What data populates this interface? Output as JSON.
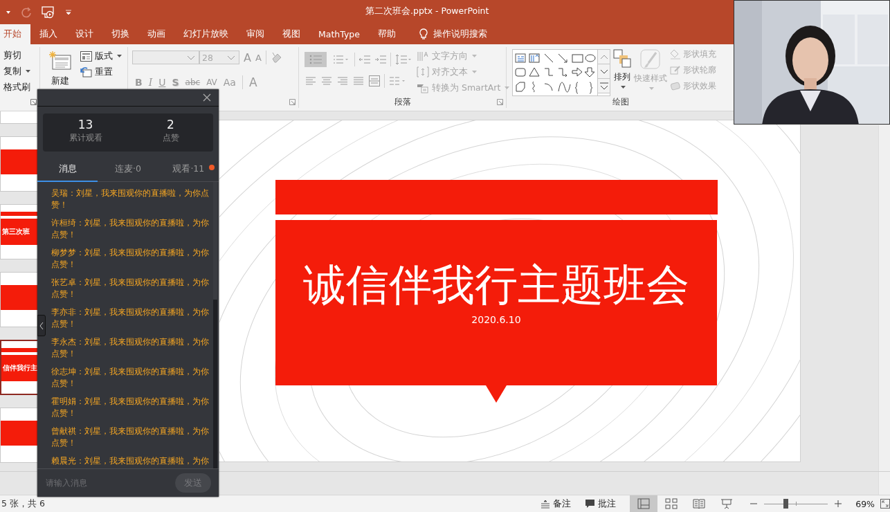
{
  "window": {
    "title": "第二次班会.pptx - PowerPoint"
  },
  "ribbon_tabs": [
    {
      "label": "开始",
      "selected": true
    },
    {
      "label": "插入",
      "selected": false
    },
    {
      "label": "设计",
      "selected": false
    },
    {
      "label": "切换",
      "selected": false
    },
    {
      "label": "动画",
      "selected": false
    },
    {
      "label": "幻灯片放映",
      "selected": false
    },
    {
      "label": "审阅",
      "selected": false
    },
    {
      "label": "视图",
      "selected": false
    },
    {
      "label": "MathType",
      "selected": false
    },
    {
      "label": "帮助",
      "selected": false
    }
  ],
  "tell_me": "操作说明搜索",
  "clipboard": {
    "commands": [
      "剪切",
      "复制",
      "格式刷"
    ]
  },
  "slides_group": {
    "new_slide": "新建",
    "commands": [
      "版式",
      "重置"
    ]
  },
  "font": {
    "disabled": true,
    "size": "28",
    "buttons": [
      {
        "label": "A",
        "kind": "grow"
      },
      {
        "label": "A",
        "kind": "shrink"
      },
      {
        "label": "B",
        "kind": "bold"
      },
      {
        "label": "I",
        "kind": "italic"
      },
      {
        "label": "U",
        "kind": "underline"
      },
      {
        "label": "S",
        "kind": "shadow"
      },
      {
        "label": "abc",
        "kind": "strike"
      },
      {
        "label": "AV",
        "kind": "spacing"
      },
      {
        "label": "Aa",
        "kind": "case"
      },
      {
        "label": "A",
        "kind": "color"
      }
    ]
  },
  "paragraph": {
    "disabled": true,
    "label": "段落",
    "commands": [
      "文字方向",
      "对齐文本",
      "转换为 SmartArt"
    ]
  },
  "drawing": {
    "label": "绘图",
    "arrange": "排列",
    "quick_styles": {
      "label": "快速样式",
      "disabled": true
    },
    "commands": [
      {
        "label": "形状填充",
        "disabled": true
      },
      {
        "label": "形状轮廓",
        "disabled": true
      },
      {
        "label": "形状效果",
        "disabled": true
      }
    ]
  },
  "thumbnails": [
    {
      "kind": "title",
      "selected": false
    },
    {
      "kind": "content",
      "selected": false
    },
    {
      "kind": "title",
      "title": "第三次班",
      "selected": false
    },
    {
      "kind": "content",
      "selected": false
    },
    {
      "kind": "title",
      "title": "信伴我行主",
      "selected": true
    },
    {
      "kind": "content",
      "selected": false
    }
  ],
  "slide": {
    "title": "诚信伴我行主题班会",
    "date": "2020.6.10"
  },
  "live_panel": {
    "stats": [
      {
        "value": "13",
        "label": "累计观看"
      },
      {
        "value": "2",
        "label": "点赞"
      }
    ],
    "tabs": [
      {
        "label": "消息",
        "selected": true,
        "badge": false
      },
      {
        "label": "连麦·0",
        "selected": false,
        "badge": false
      },
      {
        "label": "观看·11",
        "selected": false,
        "badge": true
      }
    ],
    "messages": [
      "吴瑞：刘星，我来围观你的直播啦，为你点赞！",
      "许桓绮：刘星，我来围观你的直播啦，为你点赞！",
      "柳梦梦：刘星，我来围观你的直播啦，为你点赞！",
      "张艺卓：刘星，我来围观你的直播啦，为你点赞！",
      "李亦非：刘星，我来围观你的直播啦，为你点赞！",
      "李永杰：刘星，我来围观你的直播啦，为你点赞！",
      "徐志坤：刘星，我来围观你的直播啦，为你点赞！",
      "霍明娟：刘星，我来围观你的直播啦，为你点赞！",
      "曾献祺：刘星，我来围观你的直播啦，为你点赞！",
      "赖晨光：刘星，我来围观你的直播啦，为你"
    ],
    "input": {
      "placeholder": "请输入消息"
    },
    "send_button": {
      "label": "发送",
      "disabled": true
    }
  },
  "status_bar": {
    "slide_count": "5 张，共 6",
    "notes": "备注",
    "comments": "批注",
    "views": [
      {
        "kind": "normal",
        "selected": true
      },
      {
        "kind": "sorter",
        "selected": false
      },
      {
        "kind": "reading",
        "selected": false
      },
      {
        "kind": "show",
        "selected": false
      }
    ],
    "zoom": {
      "level": 0.35,
      "reading": "69%"
    }
  }
}
